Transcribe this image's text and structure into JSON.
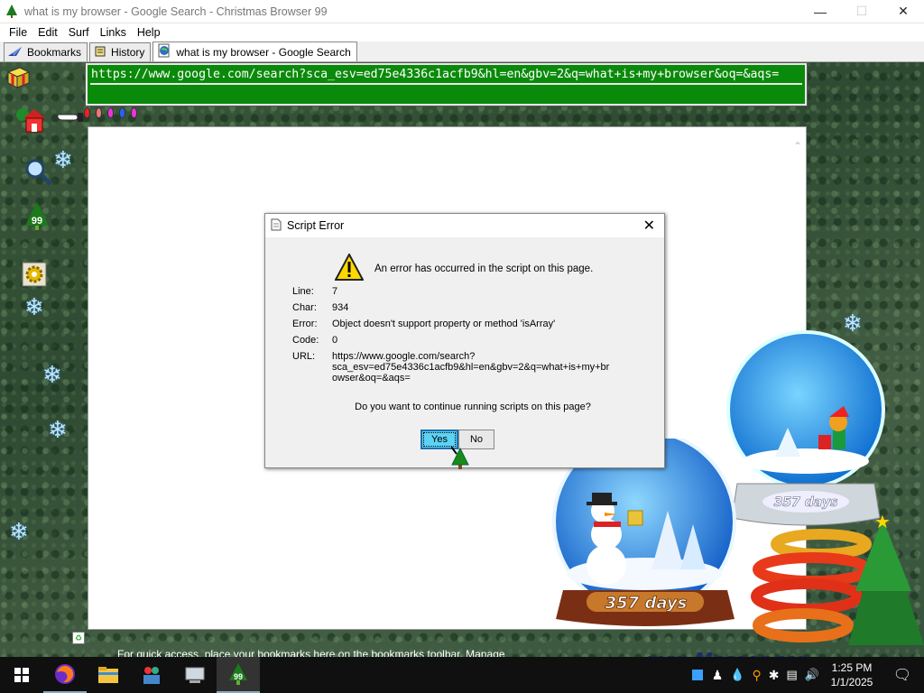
{
  "window": {
    "title": "what is my browser - Google Search - Christmas Browser 99"
  },
  "menu": [
    "File",
    "Edit",
    "Surf",
    "Links",
    "Help"
  ],
  "tabs": [
    {
      "label": "Bookmarks",
      "icon": "bookmark-plane-icon"
    },
    {
      "label": "History",
      "icon": "history-scroll-icon"
    },
    {
      "label": "what is my browser - Google Search",
      "icon": "globe-page-icon"
    }
  ],
  "sidebar_badge": "99",
  "address": {
    "url": "https://www.google.com/search?sca_esv=ed75e4336c1acfb9&hl=en&gbv=2&q=what+is+my+browser&oq=&aqs="
  },
  "status": {
    "text": "For quick access, place your bookmarks here on the bookmarks toolbar. Manage bookmarks..."
  },
  "dialog": {
    "title": "Script Error",
    "message": "An error has occurred in the script on this page.",
    "rows": [
      {
        "label": "Line:",
        "value": "7"
      },
      {
        "label": "Char:",
        "value": "934"
      },
      {
        "label": "Error:",
        "value": "Object doesn't support property or method 'isArray'"
      },
      {
        "label": "Code:",
        "value": "0"
      },
      {
        "label": "URL:",
        "value": "https://www.google.com/search?\nsca_esv=ed75e4336c1acfb9&hl=en&gbv=2&q=what+is+my+br\nowser&oq=&aqs="
      }
    ],
    "question": "Do you want to continue running scripts on this page?",
    "yes": "Yes",
    "no": "No"
  },
  "globes": {
    "countdown_1": "357 days",
    "countdown_2": "357 days"
  },
  "msn_text": "msn Messenger",
  "taskbar": {
    "time": "1:25 PM",
    "date": "1/1/2025",
    "tray_badge": "99"
  },
  "colors": {
    "url_bar": "#0a8a0a",
    "yes_button": "#5cd3f5",
    "taskbar": "#101010"
  }
}
